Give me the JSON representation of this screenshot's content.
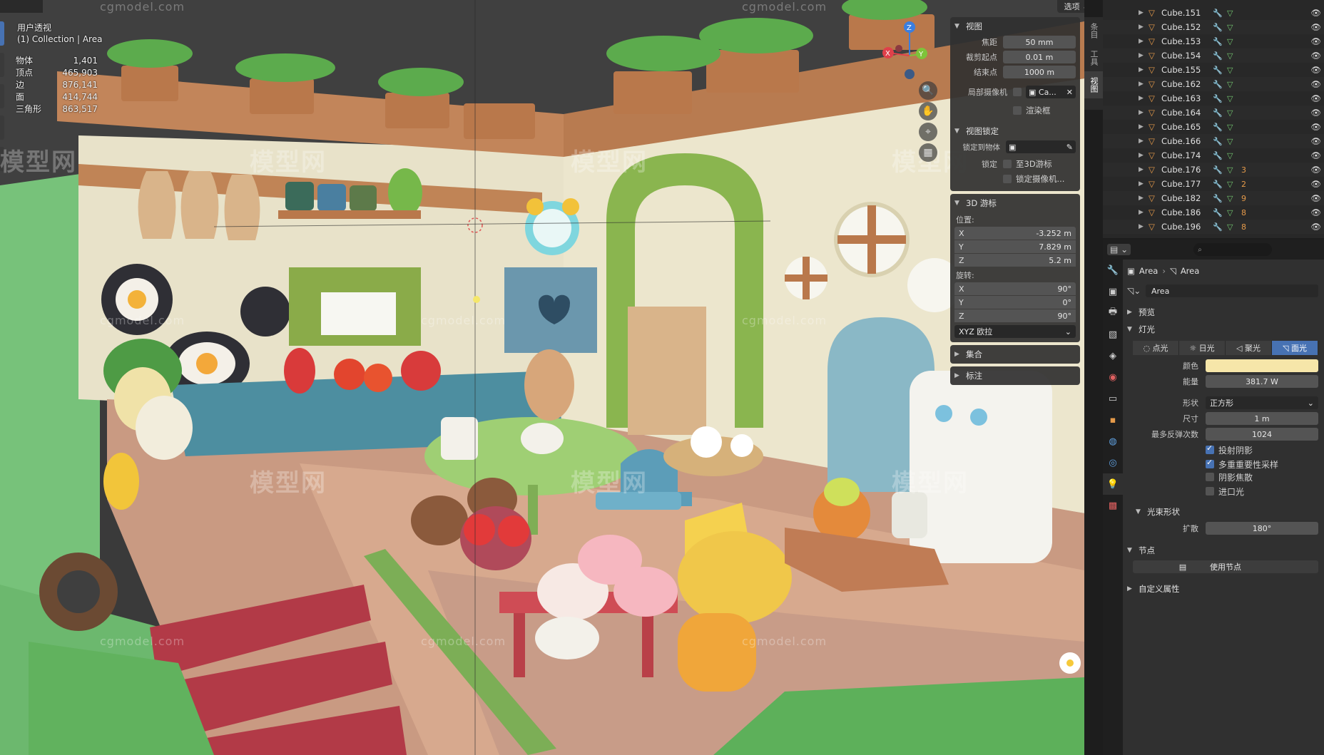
{
  "header": {
    "options_label": "选项"
  },
  "viewport_info": {
    "view_name": "用户透视",
    "collection": "(1) Collection | Area"
  },
  "stats": [
    {
      "label": "物体",
      "value": "1,401"
    },
    {
      "label": "顶点",
      "value": "465,903"
    },
    {
      "label": "边",
      "value": "876,141"
    },
    {
      "label": "面",
      "value": "414,744"
    },
    {
      "label": "三角形",
      "value": "863,517"
    }
  ],
  "gizmo": {
    "z": "Z",
    "y": "Y",
    "x": "X"
  },
  "npanel": {
    "tabs": [
      "条目",
      "工具",
      "视图"
    ],
    "view": {
      "title": "视图",
      "focal_label": "焦距",
      "focal_value": "50 mm",
      "clip_start_label": "裁剪起点",
      "clip_start_value": "0.01 m",
      "clip_end_label": "结束点",
      "clip_end_value": "1000 m",
      "local_cam_label": "局部摄像机",
      "local_cam_value": "Ca...",
      "render_region_label": "渲染框",
      "lock_title": "视图锁定",
      "lock_object_label": "锁定到物体",
      "lock_label": "锁定",
      "lock_cursor": "至3D游标",
      "lock_camera": "锁定摄像机..."
    },
    "cursor": {
      "title": "3D 游标",
      "location_label": "位置:",
      "loc": [
        {
          "axis": "X",
          "value": "-3.252 m"
        },
        {
          "axis": "Y",
          "value": "7.829 m"
        },
        {
          "axis": "Z",
          "value": "5.2 m"
        }
      ],
      "rotation_label": "旋转:",
      "rot": [
        {
          "axis": "X",
          "value": "90°"
        },
        {
          "axis": "Y",
          "value": "0°"
        },
        {
          "axis": "Z",
          "value": "90°"
        }
      ],
      "mode": "XYZ 欧拉"
    },
    "collections_label": "集合",
    "annotations_label": "标注"
  },
  "outliner": {
    "items": [
      {
        "name": "Cube.151",
        "badge": ""
      },
      {
        "name": "Cube.152",
        "badge": ""
      },
      {
        "name": "Cube.153",
        "badge": ""
      },
      {
        "name": "Cube.154",
        "badge": ""
      },
      {
        "name": "Cube.155",
        "badge": ""
      },
      {
        "name": "Cube.162",
        "badge": ""
      },
      {
        "name": "Cube.163",
        "badge": ""
      },
      {
        "name": "Cube.164",
        "badge": ""
      },
      {
        "name": "Cube.165",
        "badge": ""
      },
      {
        "name": "Cube.166",
        "badge": ""
      },
      {
        "name": "Cube.174",
        "badge": ""
      },
      {
        "name": "Cube.176",
        "badge": "3"
      },
      {
        "name": "Cube.177",
        "badge": "2"
      },
      {
        "name": "Cube.182",
        "badge": "9"
      },
      {
        "name": "Cube.186",
        "badge": "8"
      },
      {
        "name": "Cube.196",
        "badge": "8"
      }
    ]
  },
  "properties": {
    "breadcrumb_a": "Area",
    "breadcrumb_b": "Area",
    "datablock_name": "Area",
    "preview_label": "预览",
    "light_label": "灯光",
    "types": [
      "点光",
      "日光",
      "聚光",
      "面光"
    ],
    "active_type": "面光",
    "color_label": "颜色",
    "color_hex": "#f6e6a9",
    "power_label": "能量",
    "power_value": "381.7 W",
    "shape_label": "形状",
    "shape_value": "正方形",
    "size_label": "尺寸",
    "size_value": "1 m",
    "bounces_label": "最多反弹次数",
    "bounces_value": "1024",
    "cast_shadow": "投射阴影",
    "mis": "多重重要性采样",
    "shadow_caustics": "阴影焦散",
    "portal": "进口光",
    "beam_label": "光束形状",
    "spread_label": "扩散",
    "spread_value": "180°",
    "nodes_label": "节点",
    "use_nodes": "使用节点",
    "custom_props": "自定义属性"
  },
  "watermarks": {
    "brand": "模型网",
    "site": "cgmodel.com"
  },
  "colors": {
    "accent": "#4772b3",
    "panel": "#303030"
  }
}
